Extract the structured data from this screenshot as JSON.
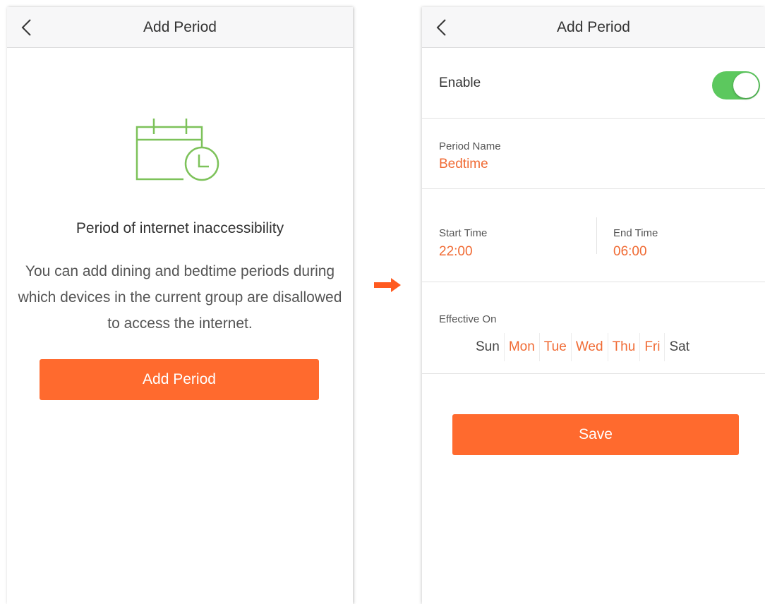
{
  "left": {
    "title": "Add Period",
    "empty_title": "Period of internet inaccessibility",
    "description": "You can add dining and bedtime periods during which devices in the current group are disallowed to access the internet.",
    "button": "Add Period",
    "icon": "calendar-clock-icon"
  },
  "right": {
    "title": "Add Period",
    "enable_label": "Enable",
    "enabled": true,
    "period_name_label": "Period Name",
    "period_name_value": "Bedtime",
    "start_label": "Start Time",
    "start_value": "22:00",
    "end_label": "End Time",
    "end_value": "06:00",
    "effective_label": "Effective On",
    "days": [
      {
        "label": "Sun",
        "selected": false
      },
      {
        "label": "Mon",
        "selected": true
      },
      {
        "label": "Tue",
        "selected": true
      },
      {
        "label": "Wed",
        "selected": true
      },
      {
        "label": "Thu",
        "selected": true
      },
      {
        "label": "Fri",
        "selected": true
      },
      {
        "label": "Sat",
        "selected": false
      }
    ],
    "save_button": "Save"
  },
  "colors": {
    "accent": "#ff6a2e",
    "selected_text": "#f06a33",
    "toggle_on": "#5cc85e",
    "icon_green": "#7dc25a"
  }
}
